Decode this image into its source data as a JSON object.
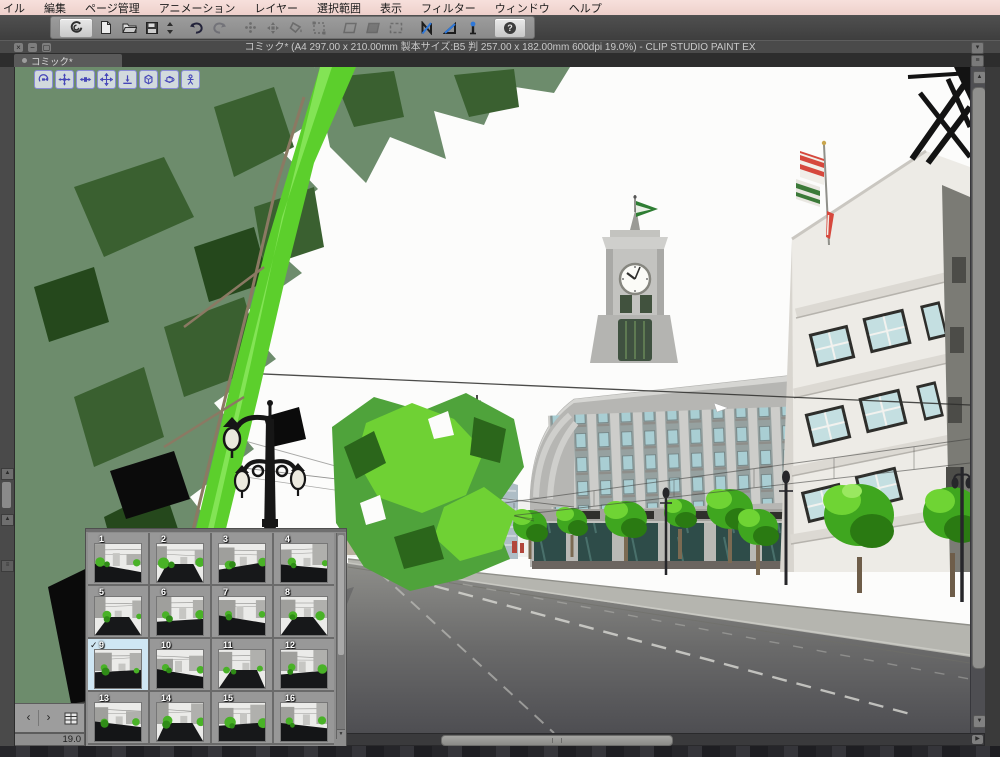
{
  "menu_bar": {
    "items": [
      "イル",
      "編集",
      "ページ管理",
      "アニメーション",
      "レイヤー",
      "選択範囲",
      "表示",
      "フィルター",
      "ウィンドウ",
      "ヘルプ"
    ]
  },
  "window": {
    "title": "コミック* (A4 297.00 x 210.00mm 製本サイズ:B5 判 257.00 x 182.00mm 600dpi 19.0%)  - CLIP STUDIO PAINT EX",
    "controls": [
      {
        "name": "close",
        "glyph": "×"
      },
      {
        "name": "minimize",
        "glyph": "−"
      },
      {
        "name": "maximize",
        "glyph": "▢"
      }
    ]
  },
  "toolbar": {
    "icons": [
      "clip-studio-logo",
      "new-document",
      "open-file",
      "save",
      "save-stepper",
      "undo",
      "redo",
      "delete-selection",
      "move-layer",
      "fill",
      "transform",
      "snap-1",
      "snap-2",
      "snap-3",
      "snap-ruler",
      "snap-special-ruler",
      "snap-grid",
      "help"
    ],
    "help_label": "?"
  },
  "tabs": {
    "active_tab": "コミック*"
  },
  "canvas": {
    "tool_icons": [
      "camera-rotate",
      "camera-pan",
      "camera-dolly",
      "object-move",
      "object-snap-to-surface",
      "object-rotate",
      "object-rotate-y",
      "object-pose"
    ]
  },
  "page_palette": {
    "pages": [
      {
        "num": "1"
      },
      {
        "num": "2"
      },
      {
        "num": "3"
      },
      {
        "num": "4"
      },
      {
        "num": "5"
      },
      {
        "num": "6"
      },
      {
        "num": "7"
      },
      {
        "num": "8"
      },
      {
        "num": "9",
        "selected": true,
        "check": "✓"
      },
      {
        "num": "10"
      },
      {
        "num": "11"
      },
      {
        "num": "12"
      },
      {
        "num": "13"
      },
      {
        "num": "14"
      },
      {
        "num": "15"
      },
      {
        "num": "16"
      }
    ]
  },
  "status": {
    "zoom": "19.0",
    "prev_glyph": "‹",
    "next_glyph": "›"
  },
  "colors": {
    "menu_bg": "#f3dad5",
    "toolbar_bg": "#454545",
    "accent_blue": "#2f78d8",
    "selected_page_bg": "#cfe6f3",
    "foliage_bright": "#5ccf2c",
    "foliage_sage": "#6d8c6c",
    "building_gray": "#b6b6b3",
    "building_white": "#edebe6",
    "road_gray": "#6e6e6b",
    "flag_red": "#d6483d",
    "flag_green": "#3c7a39"
  }
}
